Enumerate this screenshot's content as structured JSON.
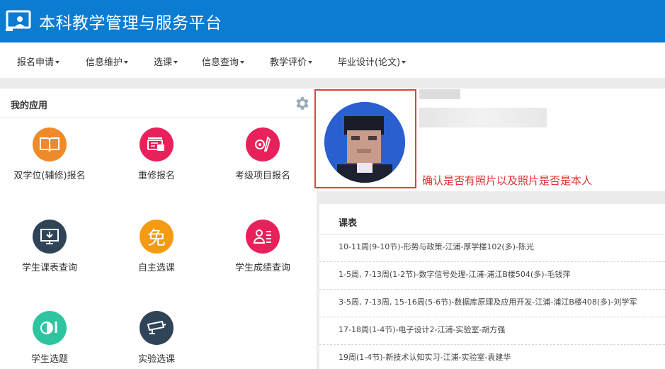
{
  "header": {
    "title": "本科教学管理与服务平台",
    "logo_icon": "monitor-user-icon",
    "bg_color": "#0c7bd2"
  },
  "nav": [
    {
      "label": "报名申请"
    },
    {
      "label": "信息维护"
    },
    {
      "label": "选课"
    },
    {
      "label": "信息查询"
    },
    {
      "label": "教学评价"
    },
    {
      "label": "毕业设计(论文)"
    }
  ],
  "apps_panel": {
    "title": "我的应用",
    "settings_icon": "gear-icon",
    "apps": [
      {
        "label": "双学位(辅修)报名",
        "icon": "book-icon",
        "color": "#ef8a2a"
      },
      {
        "label": "重修报名",
        "icon": "retake-icon",
        "color": "#e8215a"
      },
      {
        "label": "考级项目报名",
        "icon": "exam-settings-icon",
        "color": "#e8215a"
      },
      {
        "label": "学生课表查询",
        "icon": "download-monitor-icon",
        "color": "#2f4457"
      },
      {
        "label": "自主选课",
        "icon": "mian-character-icon",
        "glyph": "免",
        "color": "#f39c12"
      },
      {
        "label": "学生成绩查询",
        "icon": "grade-list-icon",
        "color": "#e8215a"
      },
      {
        "label": "学生选题",
        "icon": "topic-icon",
        "color": "#2ec4a0"
      },
      {
        "label": "实验选课",
        "icon": "camera-icon",
        "color": "#2f4457"
      }
    ]
  },
  "profile": {
    "annotation": "确认是否有照片以及照片是否是本人",
    "annotation_color": "#e03030"
  },
  "schedule": {
    "title": "课表",
    "items": [
      "10-11周(9-10节)-形势与政策-江浦-厚学楼102(多)-陈光",
      "1-5周, 7-13周(1-2节)-数字信号处理-江浦-浦江B楼504(多)-毛钱萍",
      "3-5周, 7-13周, 15-16周(5-6节)-数据库原理及应用开发-江浦-浦江B楼408(多)-刘学军",
      "17-18周(1-4节)-电子设计2-江浦-实验室-胡方强",
      "19周(1-4节)-新技术认知实习-江浦-实验室-袁建华"
    ]
  }
}
